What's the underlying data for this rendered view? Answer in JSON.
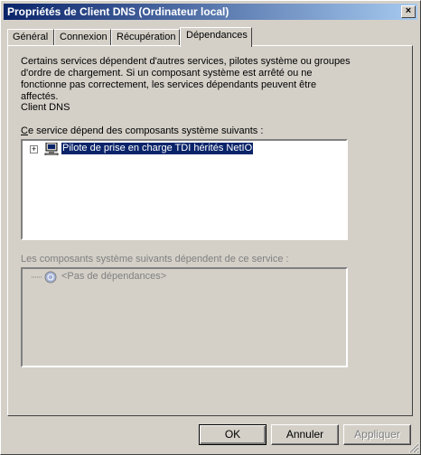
{
  "window": {
    "title": "Propriétés de Client DNS (Ordinateur local)",
    "close_label": "×"
  },
  "tabs": [
    {
      "label": "Général"
    },
    {
      "label": "Connexion"
    },
    {
      "label": "Récupération"
    },
    {
      "label": "Dépendances"
    }
  ],
  "active_tab": "Dépendances",
  "description": "Certains services dépendent d'autres services, pilotes système ou groupes d'ordre de chargement. Si un composant système est arrêté ou ne fonctionne pas correctement, les services dépendants peuvent être affectés.",
  "service_name": "Client DNS",
  "depends_on": {
    "label_first": "C",
    "label_rest": "e service dépend des composants système suivants :",
    "items": [
      {
        "label": "Pilote de prise en charge TDI hérités NetIO",
        "expander": "+"
      }
    ]
  },
  "dependents": {
    "label": "Les composants système suivants dépendent de ce service :",
    "items": [
      {
        "label": "<Pas de dépendances>"
      }
    ]
  },
  "buttons": {
    "ok": "OK",
    "cancel": "Annuler",
    "apply": "Appliquer"
  },
  "colors": {
    "titlebar_start": "#0a246a",
    "titlebar_end": "#a6caf0",
    "selection": "#0a246a",
    "face": "#d4d0c8"
  }
}
